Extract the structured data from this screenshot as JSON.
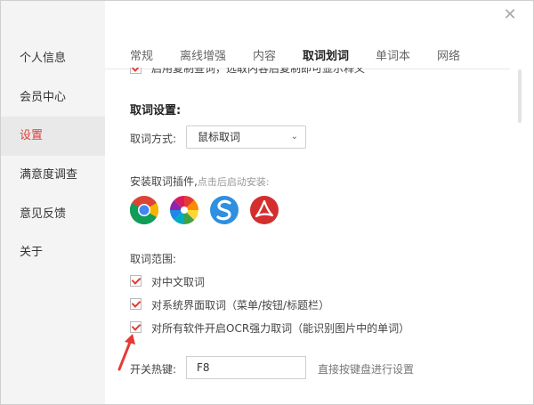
{
  "sidebar": {
    "items": [
      {
        "label": "个人信息",
        "active": false
      },
      {
        "label": "会员中心",
        "active": false
      },
      {
        "label": "设置",
        "active": true
      },
      {
        "label": "满意度调查",
        "active": false
      },
      {
        "label": "意见反馈",
        "active": false
      },
      {
        "label": "关于",
        "active": false
      }
    ]
  },
  "tabs": [
    {
      "label": "常规",
      "active": false
    },
    {
      "label": "离线增强",
      "active": false
    },
    {
      "label": "内容",
      "active": false
    },
    {
      "label": "取词划词",
      "active": true
    },
    {
      "label": "单词本",
      "active": false
    },
    {
      "label": "网络",
      "active": false
    }
  ],
  "clipped_option": {
    "label": "启用复制查词，选取内容后复制即可显示释义",
    "checked": true
  },
  "word_capture": {
    "title": "取词设置:",
    "method_label": "取词方式:",
    "method_value": "鼠标取词"
  },
  "plugins": {
    "label": "安装取词插件,",
    "hint": "点击后启动安装:",
    "items": [
      {
        "name": "chrome-icon"
      },
      {
        "name": "pinwheel-icon"
      },
      {
        "name": "sogou-icon"
      },
      {
        "name": "acrobat-icon"
      }
    ]
  },
  "scope": {
    "label": "取词范围:",
    "options": [
      {
        "label": "对中文取词",
        "checked": true
      },
      {
        "label": "对系统界面取词（菜单/按钮/标题栏）",
        "checked": true
      },
      {
        "label": "对所有软件开启OCR强力取词（能识别图片中的单词）",
        "checked": true
      }
    ]
  },
  "hotkey": {
    "label": "开关热键:",
    "value": "F8",
    "hint": "直接按键盘进行设置"
  },
  "colors": {
    "accent": "#e23c39",
    "sidebar_bg": "#f4f4f4"
  }
}
